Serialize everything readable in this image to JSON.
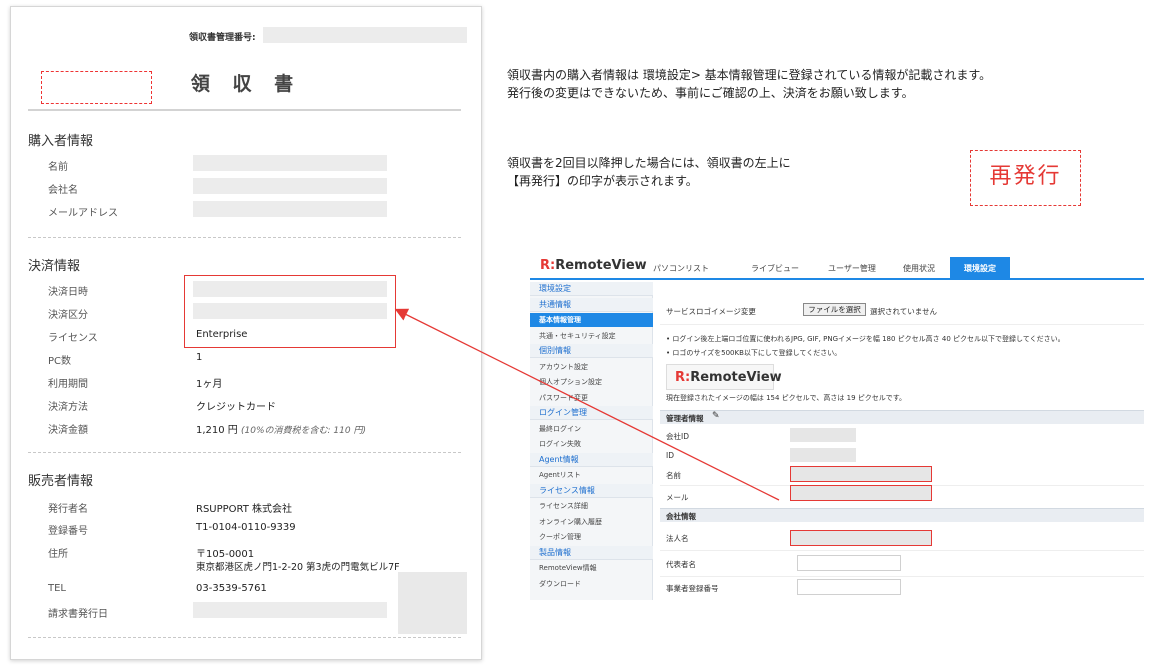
{
  "receipt": {
    "number_label": "領収書管理番号:",
    "title": "領 収 書",
    "buyer": {
      "heading": "購入者情報",
      "name_label": "名前",
      "company_label": "会社名",
      "email_label": "メールアドレス"
    },
    "payment": {
      "heading": "決済情報",
      "date_label": "決済日時",
      "type_label": "決済区分",
      "license_label": "ライセンス",
      "license_value": "Enterprise",
      "pc_label": "PC数",
      "pc_value": "1",
      "period_label": "利用期間",
      "period_value": "1ヶ月",
      "method_label": "決済方法",
      "method_value": "クレジットカード",
      "amount_label": "決済金額",
      "amount_value": "1,210 円",
      "amount_note": "(10%の消費税を含む: 110 円)"
    },
    "seller": {
      "heading": "販売者情報",
      "issuer_label": "発行者名",
      "issuer_value": "RSUPPORT 株式会社",
      "reg_label": "登録番号",
      "reg_value": "T1-0104-0110-9339",
      "address_label": "住所",
      "address_line1": "〒105-0001",
      "address_line2": "東京都港区虎ノ門1-2-20 第3虎の門電気ビル7F",
      "tel_label": "TEL",
      "tel_value": "03-3539-5761",
      "issue_date_label": "請求書発行日"
    }
  },
  "notes": {
    "line1": "領収書内の購入者情報は 環境設定> 基本情報管理に登録されている情報が記載されます。",
    "line2": "発行後の変更はできないため、事前にご確認の上、決済をお願い致します。",
    "reissue_line1": "領収書を2回目以降押した場合には、領収書の左上に",
    "reissue_line2": "【再発行】の印字が表示されます。",
    "reissue_stamp": "再発行"
  },
  "remoteview": {
    "logo_mark": "R:",
    "logo_text": "RemoteView",
    "nav": [
      "パソコンリスト",
      "ライブビュー",
      "ユーザー管理",
      "使用状況",
      "環境設定"
    ],
    "sidebar": [
      {
        "label": "環境設定",
        "kind": "cat"
      },
      {
        "label": "共通情報",
        "kind": "cat"
      },
      {
        "label": "基本情報管理",
        "kind": "active"
      },
      {
        "label": "共通・セキュリティ設定",
        "kind": "item"
      },
      {
        "label": "個別情報",
        "kind": "cat"
      },
      {
        "label": "アカウント設定",
        "kind": "item"
      },
      {
        "label": "個人オプション設定",
        "kind": "item"
      },
      {
        "label": "パスワード変更",
        "kind": "item"
      },
      {
        "label": "ログイン管理",
        "kind": "cat"
      },
      {
        "label": "最終ログイン",
        "kind": "item"
      },
      {
        "label": "ログイン失敗",
        "kind": "item"
      },
      {
        "label": "Agent情報",
        "kind": "cat"
      },
      {
        "label": "Agentリスト",
        "kind": "item"
      },
      {
        "label": "ライセンス情報",
        "kind": "cat"
      },
      {
        "label": "ライセンス詳細",
        "kind": "item"
      },
      {
        "label": "オンライン購入履歴",
        "kind": "item"
      },
      {
        "label": "クーポン管理",
        "kind": "item"
      },
      {
        "label": "製品情報",
        "kind": "cat"
      },
      {
        "label": "RemoteView情報",
        "kind": "item"
      },
      {
        "label": "ダウンロード",
        "kind": "item"
      }
    ],
    "logo_setting_label": "サービスロゴイメージ変更",
    "file_button": "ファイルを選択",
    "file_status": "選択されていません",
    "hint1": "• ログイン後左上端ロゴ位置に使われるJPG, GIF, PNGイメージを幅 180 ピクセル高さ 40 ピクセル以下で登録してください。",
    "hint2": "• ロゴのサイズを500KB以下にして登録してください。",
    "current_size": "現在登録されたイメージの幅は 154 ピクセルで、高さは 19 ピクセルです。",
    "admin_heading": "管理者情報",
    "company_id_label": "会社ID",
    "id_label": "ID",
    "name_label": "名前",
    "mail_label": "メール",
    "company_heading": "会社情報",
    "corp_name_label": "法人名",
    "rep_label": "代表者名",
    "biz_no_label": "事業者登録番号"
  }
}
